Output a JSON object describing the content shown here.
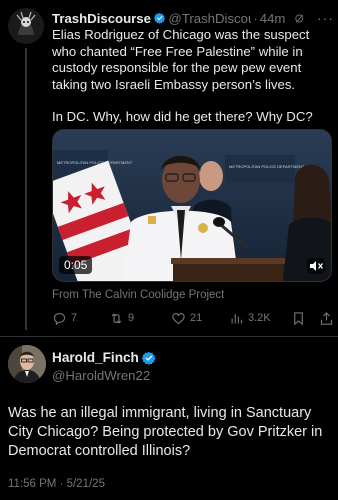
{
  "tweet1": {
    "author_name": "TrashDiscourse",
    "author_handle": "@TrashDiscour...",
    "separator": "·",
    "time": "44m",
    "more_label": "···",
    "paragraph1": "Elias Rodriguez of Chicago was the suspect who chanted “Free Free Palestine” while in custody responsible for the pew pew event taking two Israeli Embassy person’s lives.",
    "paragraph2": "In DC. Why, how did he get there? Why DC?",
    "video": {
      "duration": "0:05",
      "sign_left": "METROPOLITAN POLICE DEPARTMENT",
      "sign_right": "METROPOLITAN POLICE DEPARTMENT"
    },
    "source": "From The Calvin Coolidge Project",
    "actions": {
      "replies": "7",
      "reposts": "9",
      "likes": "21",
      "views": "3.2K"
    }
  },
  "tweet2": {
    "author_name": "Harold_Finch",
    "author_handle": "@HaroldWren22",
    "text": "Was he an illegal immigrant, living in Sanctuary City Chicago? Being protected by Gov Pritzker in Democrat controlled Illinois?",
    "timestamp": "11:56 PM · 5/21/25"
  },
  "colors": {
    "background": "#000000",
    "text": "#e7e9ea",
    "muted": "#71767b",
    "verified": "#1d9bf0",
    "divider": "#2f3336"
  }
}
